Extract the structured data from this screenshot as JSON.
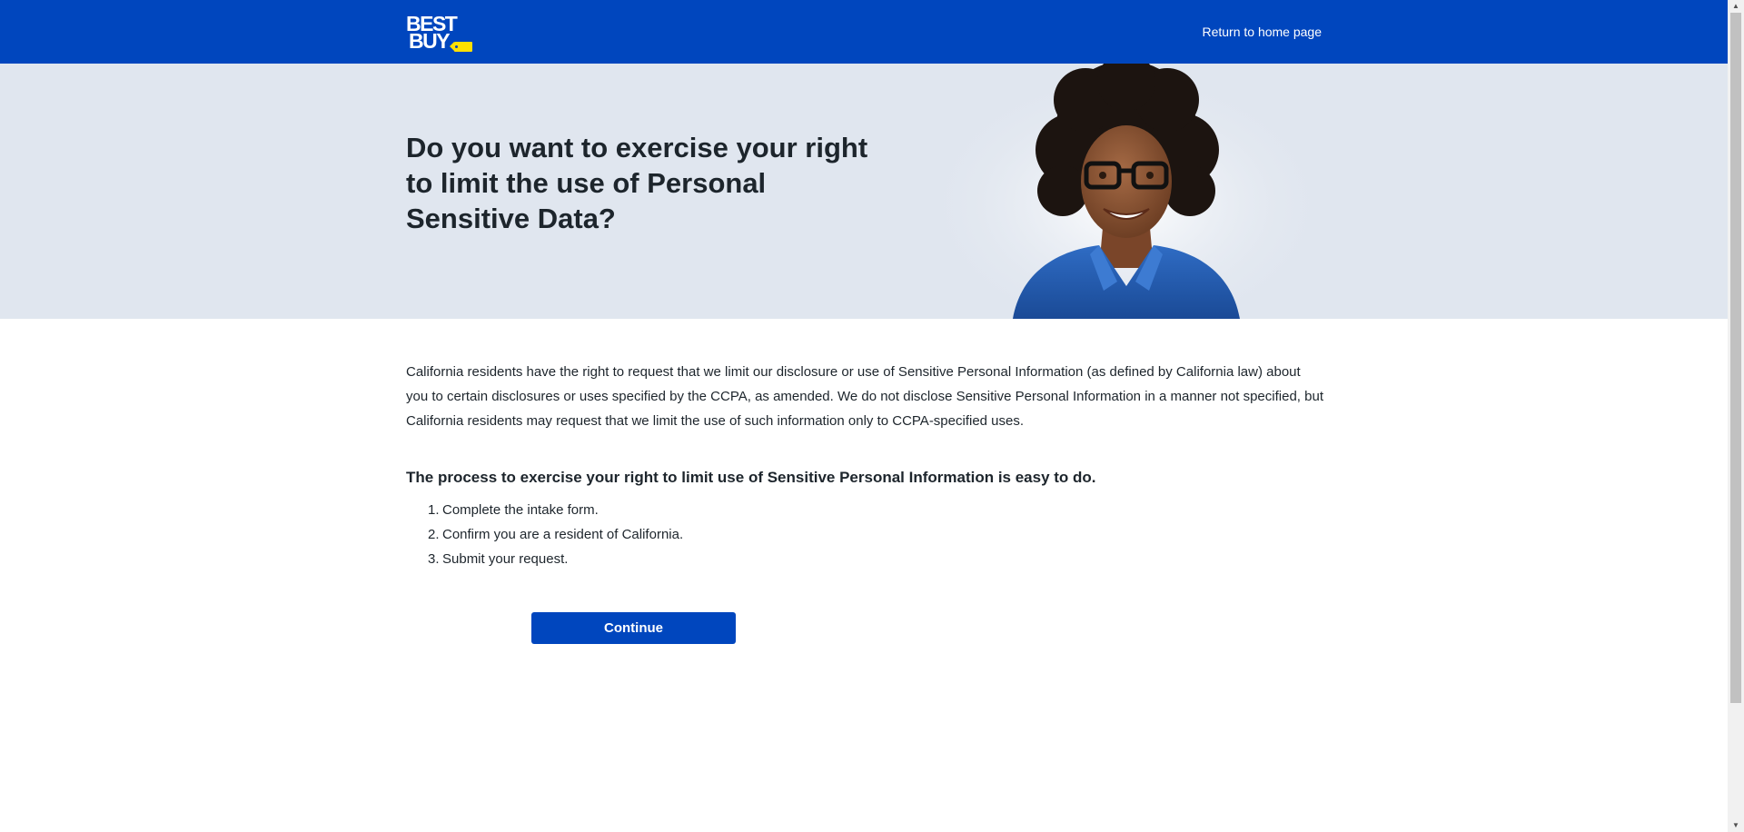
{
  "header": {
    "logo_line1": "BEST",
    "logo_line2": "BUY",
    "home_link": "Return to home page"
  },
  "hero": {
    "title": "Do you want to exercise your right to limit the use of Personal Sensitive Data?"
  },
  "content": {
    "intro": "California residents have the right to request that we limit our disclosure or use of Sensitive Personal Information (as defined by California law) about you to certain disclosures or uses specified by the CCPA, as amended. We do not disclose Sensitive Personal Information in a manner not specified, but California residents may request that we limit the use of such information only to CCPA-specified uses.",
    "process_title": "The process to exercise your right to limit use of Sensitive Personal Information is easy to do.",
    "steps": [
      {
        "num": "1.",
        "text": "Complete the intake form."
      },
      {
        "num": "2.",
        "text": "Confirm you are a resident of California."
      },
      {
        "num": "3.",
        "text": "Submit your request."
      }
    ],
    "continue_label": "Continue"
  },
  "colors": {
    "brand_blue": "#0046be",
    "brand_yellow": "#ffe000",
    "hero_bg": "#e0e6ef",
    "text": "#1d252c"
  },
  "icons": {
    "logo": "best-buy-logo",
    "hero_image": "employee-portrait",
    "scroll_up": "scroll-up-arrow-icon",
    "scroll_down": "scroll-down-arrow-icon"
  }
}
